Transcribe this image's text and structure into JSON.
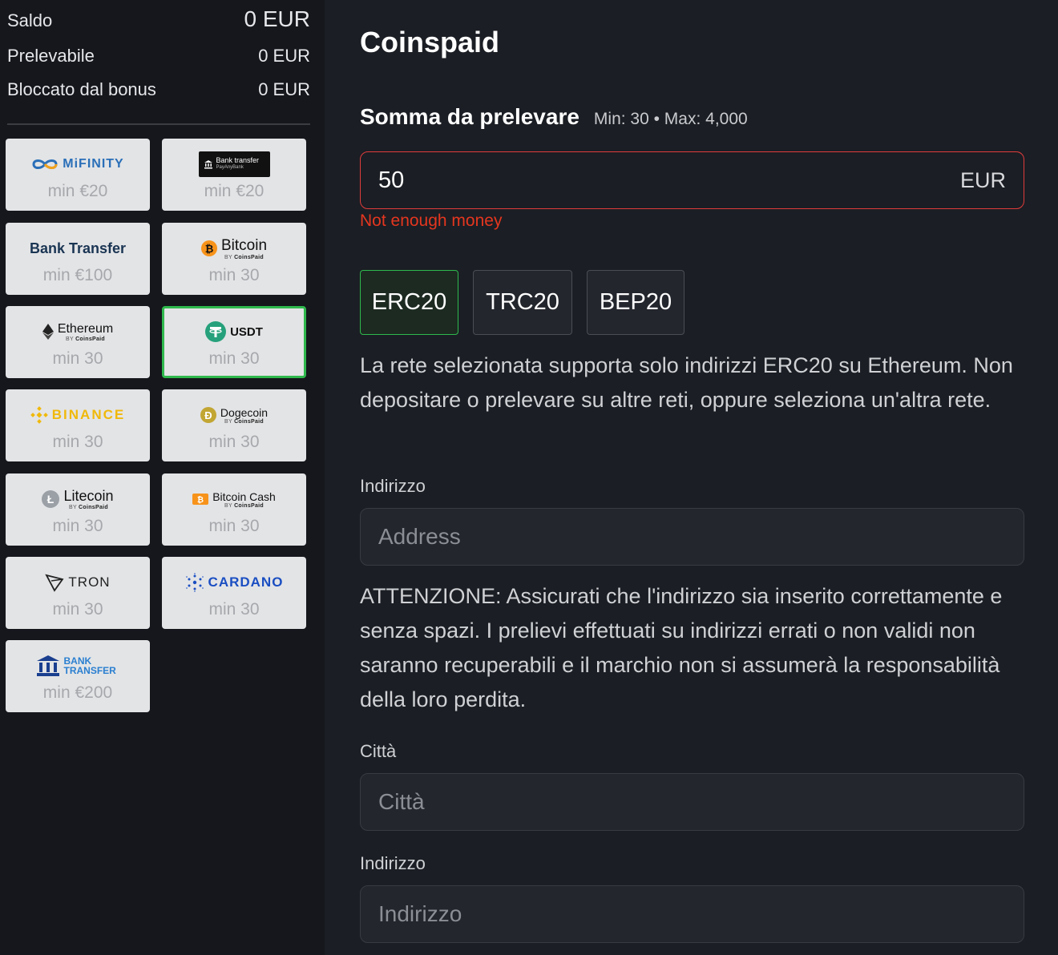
{
  "balance": {
    "saldo_label": "Saldo",
    "saldo_value": "0 EUR",
    "prelevabile_label": "Prelevabile",
    "prelevabile_value": "0 EUR",
    "bloccato_label": "Bloccato dal bonus",
    "bloccato_value": "0 EUR"
  },
  "methods": [
    {
      "name": "MiFINITY",
      "min": "min €20"
    },
    {
      "name": "Bank transfer",
      "sub": "PayAnyBank",
      "min": "min €20"
    },
    {
      "name": "Bank Transfer",
      "min": "min €100"
    },
    {
      "name": "Bitcoin",
      "min": "min 30"
    },
    {
      "name": "Ethereum",
      "min": "min 30"
    },
    {
      "name": "USDT",
      "min": "min 30"
    },
    {
      "name": "BINANCE",
      "min": "min 30"
    },
    {
      "name": "Dogecoin",
      "min": "min 30"
    },
    {
      "name": "Litecoin",
      "min": "min 30"
    },
    {
      "name": "Bitcoin Cash",
      "min": "min 30"
    },
    {
      "name": "TRON",
      "min": "min 30"
    },
    {
      "name": "CARDANO",
      "min": "min 30"
    },
    {
      "name": "BANK TRANSFER",
      "min": "min €200"
    }
  ],
  "coinspaid_sub": {
    "by": "BY",
    "brand": "CoinsPaid"
  },
  "selected_method": "USDT",
  "main": {
    "title": "Coinspaid",
    "amount_heading": "Somma da prelevare",
    "amount_limits": "Min: 30 • Max: 4,000",
    "amount_value": "50",
    "amount_currency": "EUR",
    "error": "Not enough money",
    "networks": [
      "ERC20",
      "TRC20",
      "BEP20"
    ],
    "active_network": "ERC20",
    "network_info": "La rete selezionata supporta solo indirizzi ERC20 su Ethereum. Non depositare o prelevare su altre reti, oppure seleziona un'altra rete.",
    "address_label": "Indirizzo",
    "address_placeholder": "Address",
    "warning": "ATTENZIONE: Assicurati che l'indirizzo sia inserito correttamente e senza spazi. I prelievi effettuati su indirizzi errati o non validi non saranno recuperabili e il marchio non si assumerà la responsabilità della loro perdita.",
    "city_label": "Città",
    "city_placeholder": "Città",
    "street_label": "Indirizzo",
    "street_placeholder": "Indirizzo"
  },
  "colors": {
    "accent_green": "#2fb94d",
    "error_red": "#e5361f"
  },
  "icons": [
    "mifinity-logo-icon",
    "bank-icon",
    "bitcoin-icon",
    "ethereum-icon",
    "tether-icon",
    "binance-icon",
    "dogecoin-icon",
    "litecoin-icon",
    "bitcoin-cash-icon",
    "tron-icon",
    "cardano-icon",
    "bank-building-icon"
  ]
}
